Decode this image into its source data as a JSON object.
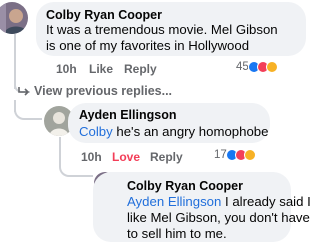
{
  "comments": [
    {
      "author": "Colby Ryan Cooper",
      "line1": "It was a tremendous movie. Mel Gibson",
      "line2": "is one of my favorites in Hollywood",
      "time": "10h",
      "like_label": "Like",
      "reply_label": "Reply",
      "reaction_count": "45",
      "reactions": [
        "like-icon",
        "love-icon",
        "haha-icon"
      ]
    },
    {
      "author": "Ayden Ellingson",
      "mention": "Colby",
      "text": " he's an angry homophobe",
      "time": "10h",
      "like_label": "Love",
      "reply_label": "Reply",
      "reaction_count": "17",
      "reactions": [
        "like-icon",
        "love-icon",
        "haha-icon"
      ]
    },
    {
      "author": "Colby Ryan Cooper",
      "mention": "Ayden Ellingson",
      "line1_rest": " I already said I",
      "line2": "like Mel Gibson,  you don't have",
      "line3": "to sell him to me."
    }
  ],
  "view_previous": "View previous replies...",
  "colors": {
    "mention": "#216fdb",
    "meta": "#65676b",
    "love": "#f33e58",
    "bubble": "#f0f2f5",
    "like": "#1877f2"
  }
}
